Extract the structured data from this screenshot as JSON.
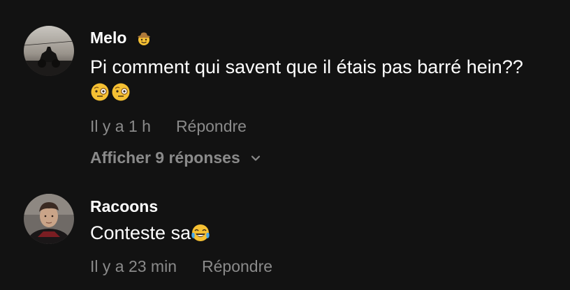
{
  "comments": [
    {
      "username": "Melo",
      "username_emoji": "cowboy-face-emoji",
      "text": "Pi comment qui savent que il étais pas barré hein??",
      "trailing_emojis": [
        "face-with-monocle-emoji",
        "face-with-monocle-emoji"
      ],
      "time": "Il y a 1 h",
      "reply_label": "Répondre",
      "view_replies_label": "Afficher 9 réponses"
    },
    {
      "username": "Racoons",
      "text": "Conteste sa",
      "trailing_emoji": "tears-of-joy-emoji",
      "time": "Il y a 23 min",
      "reply_label": "Répondre"
    }
  ],
  "colors": {
    "background": "#121212",
    "primary_text": "#ffffff",
    "secondary_text": "#8a8a8a"
  }
}
